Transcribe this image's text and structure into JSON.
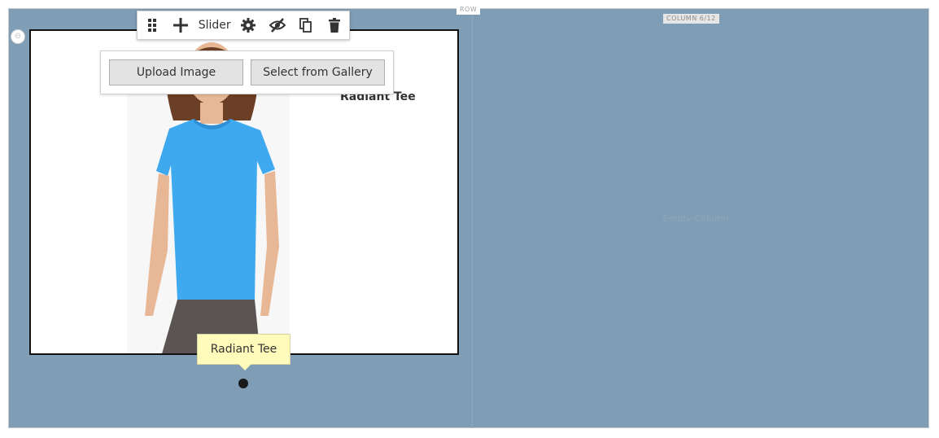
{
  "row": {
    "label": "ROW"
  },
  "column": {
    "label": "COLUMN 6/12",
    "empty_text": "Empty Column"
  },
  "toolbar": {
    "label": "Slider",
    "icons": [
      "drag-handle-icon",
      "add-icon",
      "gear-icon",
      "hide-icon",
      "duplicate-icon",
      "trash-icon"
    ]
  },
  "slide": {
    "title": "Radiant Tee",
    "upload_label": "Upload Image",
    "gallery_label": "Select from Gallery",
    "tooltip": "Radiant Tee"
  },
  "colors": {
    "row_background": "#7f9db5",
    "shirt": "#3fa9ef",
    "tooltip_bg": "#fffbbb"
  }
}
